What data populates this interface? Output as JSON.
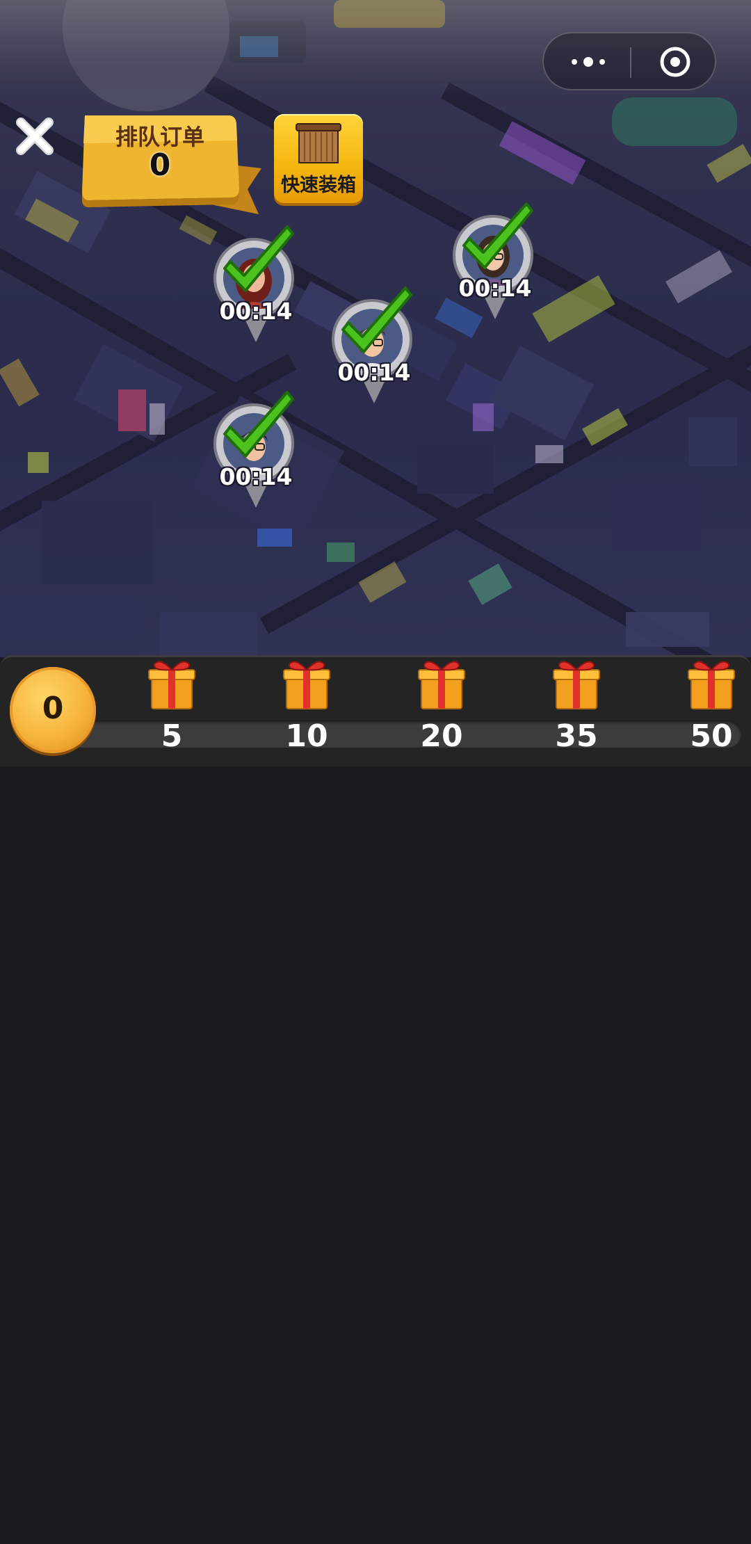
{
  "header": {
    "queue_label": "排队订单",
    "queue_count": "0",
    "quick_pack_label": "快速装箱"
  },
  "customers": [
    {
      "id": "woman-red-hair",
      "timer": "00:14",
      "served": true
    },
    {
      "id": "woman-glasses",
      "timer": "00:14",
      "served": true
    },
    {
      "id": "man-glasses",
      "timer": "00:14",
      "served": true
    },
    {
      "id": "man-glasses-2",
      "timer": "00:14",
      "served": true
    }
  ],
  "rewards": {
    "current_score": "0",
    "milestones": [
      "5",
      "10",
      "20",
      "35",
      "50"
    ]
  },
  "colors": {
    "accent_gold": "#f6b33a",
    "check_green": "#4cc21e",
    "bar_bg": "#242424",
    "page_bg": "#1c1c1e"
  },
  "icons": [
    "close-icon",
    "crate-icon",
    "gift-icon",
    "more-dots-icon",
    "target-icon",
    "checkmark-icon"
  ]
}
